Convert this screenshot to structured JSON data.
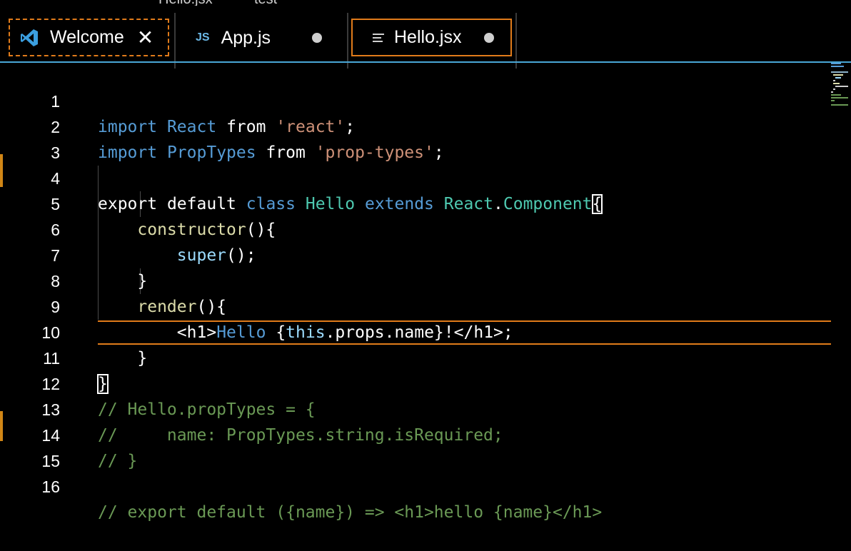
{
  "window": {
    "title_left": "Hello.jsx",
    "title_right": "test"
  },
  "tabs": [
    {
      "label": "Welcome",
      "icon": "vscode-logo-icon",
      "state": "preview",
      "action": "close"
    },
    {
      "label": "App.js",
      "icon_text": "JS",
      "state": "modified"
    },
    {
      "label": "Hello.jsx",
      "icon": "lines-file-icon",
      "state": "active-modified"
    }
  ],
  "colors": {
    "accent_border": "#49a6d6",
    "active_tab_border": "#e07b1a",
    "keyword": "#569cd6",
    "type": "#4ec9b0",
    "string": "#ce9178",
    "function": "#dcdcaa",
    "variable": "#9cdcfe",
    "comment": "#6a9955"
  },
  "editor": {
    "line_numbers": [
      "1",
      "2",
      "3",
      "4",
      "5",
      "6",
      "7",
      "8",
      "9",
      "10",
      "11",
      "12",
      "13",
      "14",
      "15",
      "16"
    ],
    "current_line": "11",
    "code": {
      "l1": [
        "import",
        " ",
        "React",
        " ",
        "from",
        " ",
        "'react'",
        ";"
      ],
      "l2": [
        "import",
        " ",
        "PropTypes",
        " ",
        "from",
        " ",
        "'prop-types'",
        ";"
      ],
      "l4": [
        "export",
        " ",
        "default",
        " ",
        "class",
        " ",
        "Hello",
        " ",
        "extends",
        " ",
        "React",
        ".",
        "Component",
        "{"
      ],
      "l5": [
        "    ",
        "constructor",
        "(){"
      ],
      "l6": [
        "        ",
        "super",
        "();"
      ],
      "l7": [
        "    }"
      ],
      "l8": [
        "    ",
        "render",
        "(){"
      ],
      "l9": [
        "        ",
        "<",
        "h1",
        ">",
        "Hello",
        " ",
        "{",
        "this",
        ".",
        "props",
        ".",
        "name",
        "}",
        "!",
        "</",
        "h1",
        ">",
        ";"
      ],
      "l10": [
        "    }"
      ],
      "l11": [
        "}"
      ],
      "l12": [
        "// Hello.propTypes = {"
      ],
      "l13": [
        "//     name: PropTypes.string.isRequired;"
      ],
      "l14": [
        "// }"
      ],
      "l16": [
        "// export default ({name}) => <h1>hello {name}</h1>"
      ]
    }
  }
}
